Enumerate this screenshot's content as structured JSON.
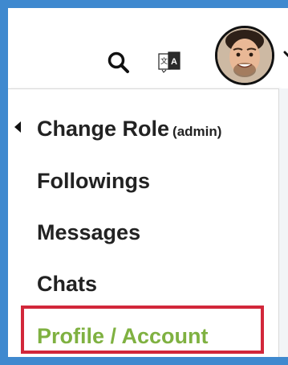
{
  "header": {
    "icons": [
      "search-icon",
      "translate-icon",
      "chevron-down-icon"
    ]
  },
  "menu": {
    "items": [
      {
        "label": "Change Role",
        "suffix": "(admin)"
      },
      {
        "label": "Followings"
      },
      {
        "label": "Messages"
      },
      {
        "label": "Chats"
      },
      {
        "label": "Profile / Account",
        "highlighted": true
      }
    ]
  },
  "colors": {
    "frame_border": "#3f89cf",
    "highlight_border": "#d2273a",
    "active_text": "#7fb141",
    "text": "#222222"
  }
}
